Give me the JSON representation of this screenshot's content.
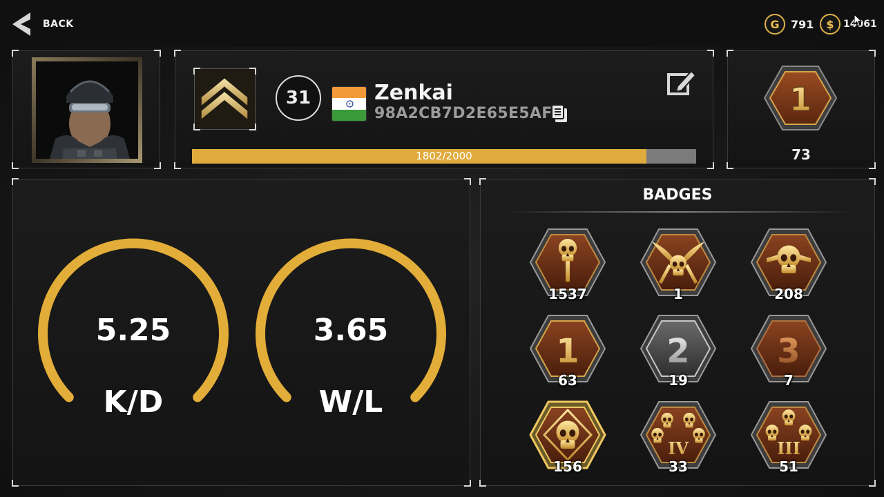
{
  "header": {
    "back_label": "BACK",
    "currencies": [
      {
        "icon": "gold-coin-icon",
        "symbol": "G",
        "amount": "791"
      },
      {
        "icon": "cash-coin-icon",
        "symbol": "$",
        "amount": "14061"
      }
    ]
  },
  "profile": {
    "level": "31",
    "country_flag": "india-flag",
    "name": "Zenkai",
    "player_id": "98A2CB7D2E65E5AF",
    "xp_text": "1802/2000",
    "xp_current": 1802,
    "xp_max": 2000
  },
  "rank": {
    "badge_numeral": "1",
    "count": "73"
  },
  "stats": {
    "kd": {
      "value": "5.25",
      "label": "K/D"
    },
    "wl": {
      "value": "3.65",
      "label": "W/L"
    }
  },
  "badges": {
    "title": "BADGES",
    "items": [
      {
        "icon": "skull-badge-icon",
        "count": "1537"
      },
      {
        "icon": "crossed-knives-skull-badge-icon",
        "count": "1"
      },
      {
        "icon": "winged-skull-badge-icon",
        "count": "208"
      },
      {
        "icon": "rank-1-badge-icon",
        "numeral": "1",
        "count": "63"
      },
      {
        "icon": "rank-2-badge-icon",
        "numeral": "2",
        "count": "19"
      },
      {
        "icon": "rank-3-badge-icon",
        "numeral": "3",
        "count": "7"
      },
      {
        "icon": "crosshair-skull-badge-icon",
        "count": "156"
      },
      {
        "icon": "four-skulls-badge-icon",
        "numeral": "IV",
        "count": "33"
      },
      {
        "icon": "three-skulls-badge-icon",
        "numeral": "III",
        "count": "51"
      }
    ]
  },
  "colors": {
    "gold": "#e0ab3d",
    "bronze": "#7a3a18",
    "silver": "#b8b8b8",
    "panel_border": "#3a3a3a"
  }
}
